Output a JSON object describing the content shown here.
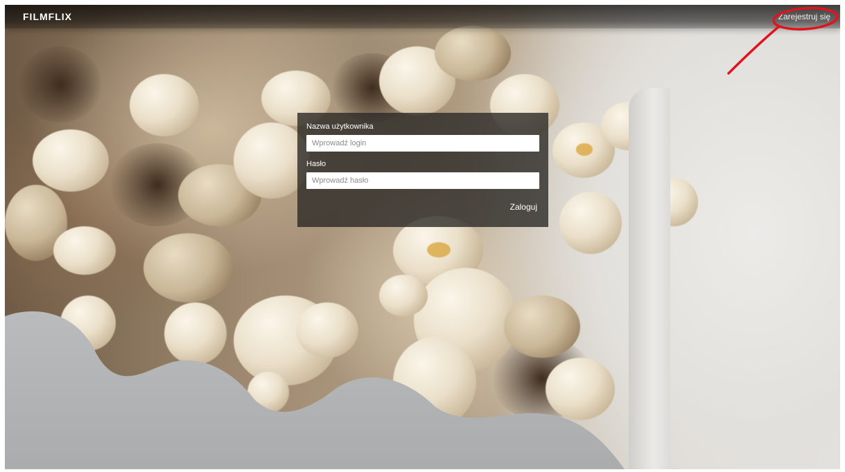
{
  "header": {
    "brand": "FILMFLIX",
    "register_label": "Zarejestruj się"
  },
  "login_form": {
    "username_label": "Nazwa użytkownika",
    "username_placeholder": "Wprowadź login",
    "username_value": "",
    "password_label": "Hasło",
    "password_placeholder": "Wprowadź hasło",
    "password_value": "",
    "submit_label": "Zaloguj"
  },
  "annotation": {
    "color": "#e0131f",
    "shape": "ellipse-with-arrow"
  },
  "colors": {
    "topbar": "#1a1a1a",
    "panel": "#2a2826",
    "text": "#ffffff"
  }
}
